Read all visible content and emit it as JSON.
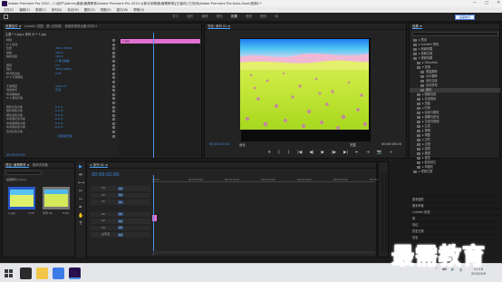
{
  "window": {
    "title": "Adobe Premiere Pro 2020 - C:\\用户\\Admin\\桌面\\最需教育\\Adobe Premiere Pro 2020 从新手到精通\\最需教育\\[已保存] 已关闭\\Adobe Premiere Pro Auto-Save\\视频0 *",
    "controls": [
      "—",
      "□",
      "✕"
    ]
  },
  "menu": [
    "文件(F)",
    "编辑(E)",
    "剪辑(C)",
    "序列(S)",
    "标记(M)",
    "图形(G)",
    "视图(V)",
    "窗口(W)",
    "帮助(H)"
  ],
  "workspace": {
    "tabs": [
      "学习",
      "组件",
      "编辑",
      "颜色",
      "效果",
      "音频",
      "图形",
      "库"
    ],
    "active_tab": "效果",
    "badge": "最需教育"
  },
  "effect_controls": {
    "tabs": [
      "效果控件 ≡",
      "Lumetri 范围",
      "源:(无剪辑)",
      "音频剪辑混合器:序列01"
    ],
    "source": "主要 * 1.jpg  ▸  序列 01 * 1.jpg",
    "clip_label": "1.jpg",
    "timecode": "00:00:02:00",
    "rows": [
      {
        "name": "视频",
        "value": ""
      },
      {
        "name": "fx ▾ 运动",
        "value": ""
      },
      {
        "name": "位置",
        "value": "360.0   288.0"
      },
      {
        "name": "缩放",
        "value": "100.0"
      },
      {
        "name": "缩放宽度",
        "value": "100.0"
      },
      {
        "name": "",
        "value": "☑ 等比缩放"
      },
      {
        "name": "旋转",
        "value": "0.0"
      },
      {
        "name": "锚点",
        "value": "360.0   288.0"
      },
      {
        "name": "防闪烁滤镜",
        "value": "0.00"
      },
      {
        "name": "fx ▾ 不透明度",
        "value": ""
      },
      {
        "name": "",
        "value": ""
      },
      {
        "name": "不透明度",
        "value": "100.0 %"
      },
      {
        "name": "混合模式",
        "value": "正常"
      },
      {
        "name": "时间重映射",
        "value": ""
      },
      {
        "name": "fx ▾ 颜色平衡",
        "value": ""
      },
      {
        "name": "",
        "value": ""
      },
      {
        "name": "阴影红色平衡",
        "value": "0.0 %"
      },
      {
        "name": "阴影绿色平衡",
        "value": "0.0 %"
      },
      {
        "name": "阴影蓝色平衡",
        "value": "0.0 %"
      },
      {
        "name": "中间调红色平衡",
        "value": "0.0 %"
      },
      {
        "name": "中间调绿色平衡",
        "value": "0.0 %"
      },
      {
        "name": "中间调蓝色平衡",
        "value": "0.0 %"
      },
      {
        "name": "高光红色平衡",
        "value": ""
      },
      {
        "name": "",
        "value": "☐ 保持发光度"
      }
    ]
  },
  "program": {
    "tabs": [
      "节目: 序列 01 ≡"
    ],
    "timecode_left": "00:00:02:00",
    "fit": "适合",
    "quality": "完整",
    "timecode_right": "00:00:05:00",
    "controls": [
      "▾",
      "{",
      "}",
      "|◀",
      "◀|",
      "▶",
      "|▶",
      "▶|",
      "⇤",
      "⇥",
      "📷",
      "+"
    ]
  },
  "library": {
    "title": "效果 ≡",
    "items": [
      {
        "label": "▸ 预设",
        "indent": 1
      },
      {
        "label": "▸ Lumetri 预设",
        "indent": 1
      },
      {
        "label": "▸ 音频效果",
        "indent": 1
      },
      {
        "label": "▸ 音频过渡",
        "indent": 1
      },
      {
        "label": "▾ 视频效果",
        "indent": 1
      },
      {
        "label": "▸ Obsolete",
        "indent": 2
      },
      {
        "label": "▾ 变换",
        "indent": 2
      },
      {
        "label": "垂直翻转",
        "indent": 3
      },
      {
        "label": "水平翻转",
        "indent": 3
      },
      {
        "label": "羽化边缘",
        "indent": 3
      },
      {
        "label": "自动重构",
        "indent": 3
      },
      {
        "label": "裁剪",
        "indent": 3,
        "selected": true
      },
      {
        "label": "▸ 图像控制",
        "indent": 2
      },
      {
        "label": "▸ 实用程序",
        "indent": 2
      },
      {
        "label": "▸ 扭曲",
        "indent": 2
      },
      {
        "label": "▸ 时间",
        "indent": 2
      },
      {
        "label": "▸ 杂色与颗粒",
        "indent": 2
      },
      {
        "label": "▸ 模糊与锐化",
        "indent": 2
      },
      {
        "label": "▸ 沉浸式视频",
        "indent": 2
      },
      {
        "label": "▸ 生成",
        "indent": 2
      },
      {
        "label": "▸ 视频",
        "indent": 2
      },
      {
        "label": "▸ 调整",
        "indent": 2
      },
      {
        "label": "▸ 过时",
        "indent": 2
      },
      {
        "label": "▸ 过渡",
        "indent": 2
      },
      {
        "label": "▸ 透视",
        "indent": 2
      },
      {
        "label": "▸ 通道",
        "indent": 2
      },
      {
        "label": "▸ 键控",
        "indent": 2
      },
      {
        "label": "▸ 颜色校正",
        "indent": 2
      },
      {
        "label": "▸ 风格化",
        "indent": 2
      },
      {
        "label": "▸ 视频过渡",
        "indent": 1
      }
    ],
    "sections": [
      "基本图形",
      "基本声音",
      "Lumetri 颜色",
      "库",
      "标记",
      "历史记录",
      "信息"
    ]
  },
  "project": {
    "tabs": [
      "项目: 最需教育 ≡",
      "媒体浏览器"
    ],
    "file": "最需教育.prproj",
    "thumbs": [
      {
        "label": "1.jpg",
        "duration": "5:00"
      },
      {
        "label": "序列 01",
        "duration": "5:00"
      }
    ]
  },
  "tools": [
    "▶",
    "⇹",
    "⟷",
    "✂",
    "⇿",
    "✒",
    "✋",
    "T"
  ],
  "timeline": {
    "tabs": [
      "× 序列 01 ≡"
    ],
    "timecode": "00:00:02:00",
    "ruler": [
      "00:00",
      "00:00:05:00",
      "00:00:10:00",
      "00:00:15:00",
      "00:00:20:00",
      "00:00:25:00",
      "00:00:30:00"
    ],
    "tracks": [
      {
        "name": "V3",
        "label": "V3"
      },
      {
        "name": "V2",
        "label": "V2"
      },
      {
        "name": "V1",
        "label": "V1"
      },
      {
        "name": "A1",
        "label": "A1"
      },
      {
        "name": "A2",
        "label": "A2"
      },
      {
        "name": "A3",
        "label": "A3"
      },
      {
        "name": "主声道",
        "label": "0.0"
      }
    ]
  },
  "taskbar": {
    "tray": [
      "^",
      "⌨",
      "🔊",
      "中"
    ],
    "time": "11:16",
    "date": "2022/4/9"
  },
  "watermark": "最需教育"
}
